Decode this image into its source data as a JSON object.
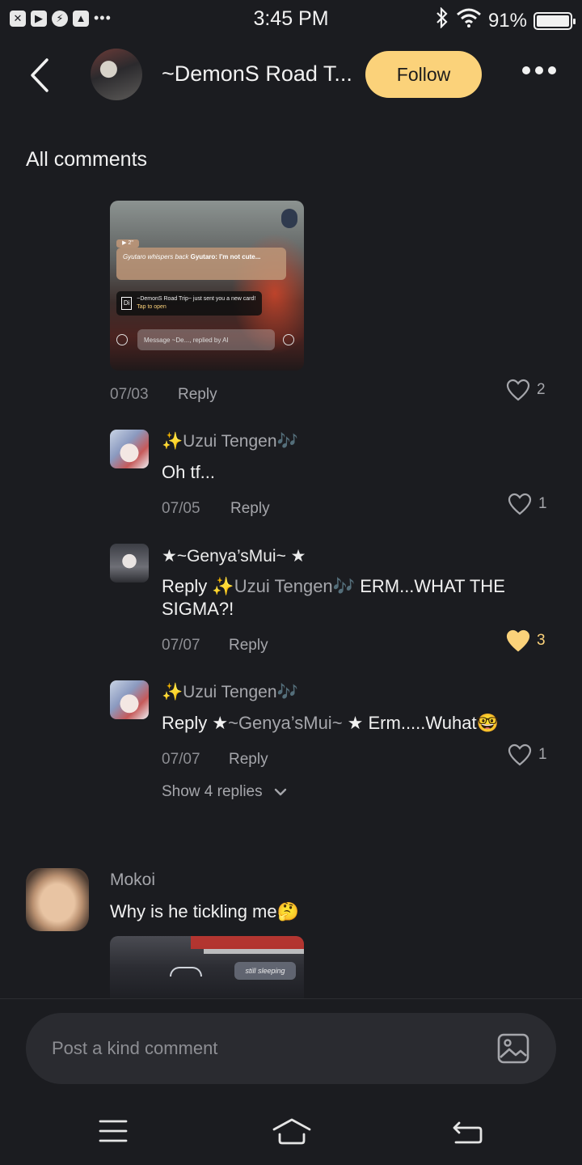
{
  "status_bar": {
    "time": "3:45 PM",
    "battery": "91%",
    "app_icons": [
      "close-box-icon",
      "play-icon",
      "messenger-icon",
      "gallery-icon"
    ],
    "overflow": "•••"
  },
  "header": {
    "title": "~DemonS Road T...",
    "follow_label": "Follow"
  },
  "section_title": "All comments",
  "media_card": {
    "badge": "▶ 2\"",
    "bubble_italic": "Gyutaro whispers back",
    "bubble_bold": "Gyutaro: I'm not cute...",
    "notify_text": "~DemonS Road Trip~ just sent you a new card!",
    "notify_tap": "Tap to open",
    "message_placeholder": "Message ~De..., replied by AI"
  },
  "top_comment": {
    "date": "07/03",
    "reply_label": "Reply",
    "likes": "2"
  },
  "replies": [
    {
      "name_prefix": "✨",
      "name": "Uzui Tengen",
      "name_suffix": "🎶",
      "body": "Oh tf...",
      "date": "07/05",
      "reply_label": "Reply",
      "likes": "1",
      "liked": false
    },
    {
      "name": "★~Genya’sMui~ ★",
      "body_prefix": "Reply ",
      "mention_spark": "✨",
      "mention": "Uzui Tengen",
      "mention_note": "🎶",
      "body": " ERM...WHAT THE SIGMA?!",
      "date": "07/07",
      "reply_label": "Reply",
      "likes": "3",
      "liked": true
    },
    {
      "name_prefix": "✨",
      "name": "Uzui Tengen",
      "name_suffix": "🎶",
      "body_prefix": "Reply ",
      "mention_star1": "★",
      "mention": "~Genya’sMui~",
      "mention_star2": " ★",
      "body": " Erm.....Wuhat🤓",
      "date": "07/07",
      "reply_label": "Reply",
      "likes": "1",
      "liked": false
    }
  ],
  "show_more_label": "Show 4 replies",
  "second_comment": {
    "name": "Mokoi",
    "body": "Why is he tickling me🤔",
    "card_tag": "still sleeping"
  },
  "composer": {
    "placeholder": "Post a kind comment"
  },
  "colors": {
    "accent": "#fbd27a",
    "background": "#1b1c20",
    "muted_text": "#a5a6ab"
  }
}
